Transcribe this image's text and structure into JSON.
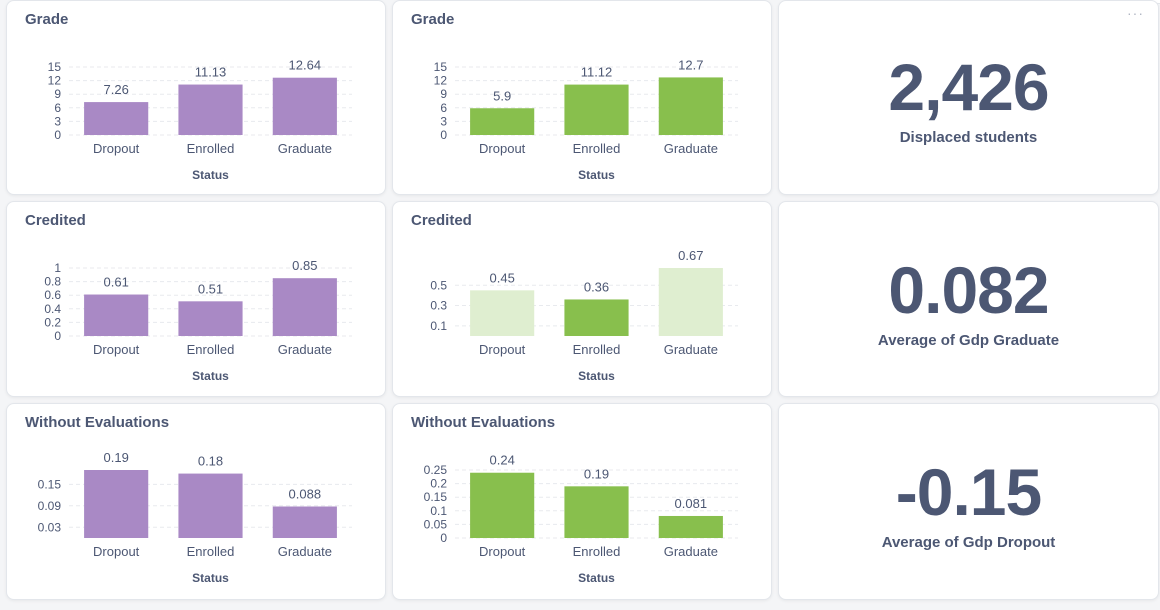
{
  "charts": [
    {
      "title": "Grade",
      "chart_data": {
        "type": "bar",
        "categories": [
          "Dropout",
          "Enrolled",
          "Graduate"
        ],
        "values": [
          7.26,
          11.13,
          12.64
        ],
        "labels": [
          "7.26",
          "11.13",
          "12.64"
        ],
        "title": "Grade",
        "xlabel": "Status",
        "ylabel": "",
        "yticks": [
          "0",
          "3",
          "6",
          "9",
          "12",
          "15"
        ],
        "ylim": [
          0,
          15
        ],
        "colors": [
          "#a989c5",
          "#a989c5",
          "#a989c5"
        ],
        "grid": true
      }
    },
    {
      "title": "Grade",
      "chart_data": {
        "type": "bar",
        "categories": [
          "Dropout",
          "Enrolled",
          "Graduate"
        ],
        "values": [
          5.9,
          11.12,
          12.7
        ],
        "labels": [
          "5.9",
          "11.12",
          "12.7"
        ],
        "title": "Grade",
        "xlabel": "Status",
        "ylabel": "",
        "yticks": [
          "0",
          "3",
          "6",
          "9",
          "12",
          "15"
        ],
        "ylim": [
          0,
          15
        ],
        "colors": [
          "#88bf4d",
          "#88bf4d",
          "#88bf4d"
        ],
        "grid": true
      }
    },
    {
      "title": "Credited",
      "chart_data": {
        "type": "bar",
        "categories": [
          "Dropout",
          "Enrolled",
          "Graduate"
        ],
        "values": [
          0.61,
          0.51,
          0.85
        ],
        "labels": [
          "0.61",
          "0.51",
          "0.85"
        ],
        "title": "Credited",
        "xlabel": "Status",
        "ylabel": "",
        "yticks": [
          "0",
          "0.2",
          "0.4",
          "0.6",
          "0.8",
          "1"
        ],
        "ylim": [
          0,
          1
        ],
        "colors": [
          "#a989c5",
          "#a989c5",
          "#a989c5"
        ],
        "grid": true
      }
    },
    {
      "title": "Credited",
      "chart_data": {
        "type": "bar",
        "categories": [
          "Dropout",
          "Enrolled",
          "Graduate"
        ],
        "values": [
          0.45,
          0.36,
          0.67
        ],
        "labels": [
          "0.45",
          "0.36",
          "0.67"
        ],
        "title": "Credited",
        "xlabel": "Status",
        "ylabel": "",
        "yticks": [
          "0.1",
          "0.3",
          "0.5"
        ],
        "ylim": [
          0,
          0.67
        ],
        "colors": [
          "#dfeed0",
          "#88bf4d",
          "#dfeed0"
        ],
        "grid": true
      }
    },
    {
      "title": "Without Evaluations",
      "chart_data": {
        "type": "bar",
        "categories": [
          "Dropout",
          "Enrolled",
          "Graduate"
        ],
        "values": [
          0.19,
          0.18,
          0.088
        ],
        "labels": [
          "0.19",
          "0.18",
          "0.088"
        ],
        "title": "Without Evaluations",
        "xlabel": "Status",
        "ylabel": "",
        "yticks": [
          "0.03",
          "0.09",
          "0.15"
        ],
        "ylim": [
          0,
          0.19
        ],
        "colors": [
          "#a989c5",
          "#a989c5",
          "#a989c5"
        ],
        "grid": true
      }
    },
    {
      "title": "Without Evaluations",
      "chart_data": {
        "type": "bar",
        "categories": [
          "Dropout",
          "Enrolled",
          "Graduate"
        ],
        "values": [
          0.24,
          0.19,
          0.081
        ],
        "labels": [
          "0.24",
          "0.19",
          "0.081"
        ],
        "title": "Without Evaluations",
        "xlabel": "Status",
        "ylabel": "",
        "yticks": [
          "0",
          "0.05",
          "0.1",
          "0.15",
          "0.2",
          "0.25"
        ],
        "ylim": [
          0,
          0.25
        ],
        "colors": [
          "#88bf4d",
          "#88bf4d",
          "#88bf4d"
        ],
        "grid": true
      }
    }
  ],
  "scalars": [
    {
      "value": "2,426",
      "label": "Displaced students"
    },
    {
      "value": "0.082",
      "label": "Average of Gdp Graduate"
    },
    {
      "value": "-0.15",
      "label": "Average of Gdp Dropout"
    }
  ],
  "menu": {
    "more_icon": "···"
  }
}
